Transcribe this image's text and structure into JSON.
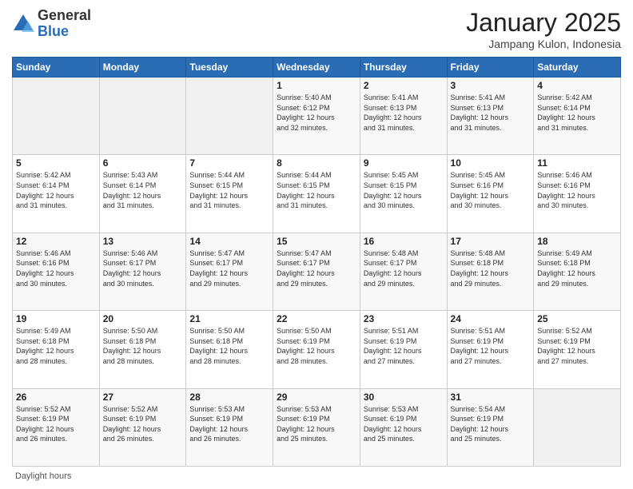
{
  "header": {
    "logo_general": "General",
    "logo_blue": "Blue",
    "month_title": "January 2025",
    "location": "Jampang Kulon, Indonesia"
  },
  "days_of_week": [
    "Sunday",
    "Monday",
    "Tuesday",
    "Wednesday",
    "Thursday",
    "Friday",
    "Saturday"
  ],
  "footer_text": "Daylight hours",
  "weeks": [
    [
      {
        "day": "",
        "info": ""
      },
      {
        "day": "",
        "info": ""
      },
      {
        "day": "",
        "info": ""
      },
      {
        "day": "1",
        "info": "Sunrise: 5:40 AM\nSunset: 6:12 PM\nDaylight: 12 hours\nand 32 minutes."
      },
      {
        "day": "2",
        "info": "Sunrise: 5:41 AM\nSunset: 6:13 PM\nDaylight: 12 hours\nand 31 minutes."
      },
      {
        "day": "3",
        "info": "Sunrise: 5:41 AM\nSunset: 6:13 PM\nDaylight: 12 hours\nand 31 minutes."
      },
      {
        "day": "4",
        "info": "Sunrise: 5:42 AM\nSunset: 6:14 PM\nDaylight: 12 hours\nand 31 minutes."
      }
    ],
    [
      {
        "day": "5",
        "info": "Sunrise: 5:42 AM\nSunset: 6:14 PM\nDaylight: 12 hours\nand 31 minutes."
      },
      {
        "day": "6",
        "info": "Sunrise: 5:43 AM\nSunset: 6:14 PM\nDaylight: 12 hours\nand 31 minutes."
      },
      {
        "day": "7",
        "info": "Sunrise: 5:44 AM\nSunset: 6:15 PM\nDaylight: 12 hours\nand 31 minutes."
      },
      {
        "day": "8",
        "info": "Sunrise: 5:44 AM\nSunset: 6:15 PM\nDaylight: 12 hours\nand 31 minutes."
      },
      {
        "day": "9",
        "info": "Sunrise: 5:45 AM\nSunset: 6:15 PM\nDaylight: 12 hours\nand 30 minutes."
      },
      {
        "day": "10",
        "info": "Sunrise: 5:45 AM\nSunset: 6:16 PM\nDaylight: 12 hours\nand 30 minutes."
      },
      {
        "day": "11",
        "info": "Sunrise: 5:46 AM\nSunset: 6:16 PM\nDaylight: 12 hours\nand 30 minutes."
      }
    ],
    [
      {
        "day": "12",
        "info": "Sunrise: 5:46 AM\nSunset: 6:16 PM\nDaylight: 12 hours\nand 30 minutes."
      },
      {
        "day": "13",
        "info": "Sunrise: 5:46 AM\nSunset: 6:17 PM\nDaylight: 12 hours\nand 30 minutes."
      },
      {
        "day": "14",
        "info": "Sunrise: 5:47 AM\nSunset: 6:17 PM\nDaylight: 12 hours\nand 29 minutes."
      },
      {
        "day": "15",
        "info": "Sunrise: 5:47 AM\nSunset: 6:17 PM\nDaylight: 12 hours\nand 29 minutes."
      },
      {
        "day": "16",
        "info": "Sunrise: 5:48 AM\nSunset: 6:17 PM\nDaylight: 12 hours\nand 29 minutes."
      },
      {
        "day": "17",
        "info": "Sunrise: 5:48 AM\nSunset: 6:18 PM\nDaylight: 12 hours\nand 29 minutes."
      },
      {
        "day": "18",
        "info": "Sunrise: 5:49 AM\nSunset: 6:18 PM\nDaylight: 12 hours\nand 29 minutes."
      }
    ],
    [
      {
        "day": "19",
        "info": "Sunrise: 5:49 AM\nSunset: 6:18 PM\nDaylight: 12 hours\nand 28 minutes."
      },
      {
        "day": "20",
        "info": "Sunrise: 5:50 AM\nSunset: 6:18 PM\nDaylight: 12 hours\nand 28 minutes."
      },
      {
        "day": "21",
        "info": "Sunrise: 5:50 AM\nSunset: 6:18 PM\nDaylight: 12 hours\nand 28 minutes."
      },
      {
        "day": "22",
        "info": "Sunrise: 5:50 AM\nSunset: 6:19 PM\nDaylight: 12 hours\nand 28 minutes."
      },
      {
        "day": "23",
        "info": "Sunrise: 5:51 AM\nSunset: 6:19 PM\nDaylight: 12 hours\nand 27 minutes."
      },
      {
        "day": "24",
        "info": "Sunrise: 5:51 AM\nSunset: 6:19 PM\nDaylight: 12 hours\nand 27 minutes."
      },
      {
        "day": "25",
        "info": "Sunrise: 5:52 AM\nSunset: 6:19 PM\nDaylight: 12 hours\nand 27 minutes."
      }
    ],
    [
      {
        "day": "26",
        "info": "Sunrise: 5:52 AM\nSunset: 6:19 PM\nDaylight: 12 hours\nand 26 minutes."
      },
      {
        "day": "27",
        "info": "Sunrise: 5:52 AM\nSunset: 6:19 PM\nDaylight: 12 hours\nand 26 minutes."
      },
      {
        "day": "28",
        "info": "Sunrise: 5:53 AM\nSunset: 6:19 PM\nDaylight: 12 hours\nand 26 minutes."
      },
      {
        "day": "29",
        "info": "Sunrise: 5:53 AM\nSunset: 6:19 PM\nDaylight: 12 hours\nand 25 minutes."
      },
      {
        "day": "30",
        "info": "Sunrise: 5:53 AM\nSunset: 6:19 PM\nDaylight: 12 hours\nand 25 minutes."
      },
      {
        "day": "31",
        "info": "Sunrise: 5:54 AM\nSunset: 6:19 PM\nDaylight: 12 hours\nand 25 minutes."
      },
      {
        "day": "",
        "info": ""
      }
    ]
  ]
}
